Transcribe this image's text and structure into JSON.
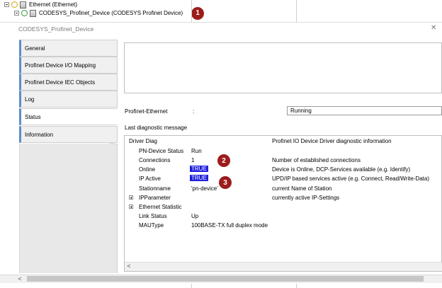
{
  "tree": {
    "ethernet_label": "Ethernet (Ethernet)",
    "device_label": "CODESYS_Profinet_Device (CODESYS Profinet Device)",
    "badge_1": "1"
  },
  "dialog": {
    "title": "CODESYS_Profinet_Device",
    "close_glyph": "✕"
  },
  "tabs": [
    {
      "label": "General"
    },
    {
      "label": "Profinet Device I/O Mapping"
    },
    {
      "label": "Profinet Device IEC Objects"
    },
    {
      "label": "Log"
    },
    {
      "label": "Status"
    },
    {
      "label": "Information"
    }
  ],
  "status": {
    "profinet_ethernet_label": "Profinet-Ethernet",
    "colon": ":",
    "state_value": "Running",
    "last_diag_label": "Last diagnostic message"
  },
  "diag": {
    "header_name": "Driver Diag",
    "header_desc": "Profinet IO Device Driver diagnostic information",
    "rows": [
      {
        "name": "PN-Device Status",
        "value": "Run",
        "desc": ""
      },
      {
        "name": "Connections",
        "value": "1",
        "desc": "Number of established connections"
      },
      {
        "name": "Online",
        "value": "TRUE",
        "desc": "Device is Online, DCP-Services available (e.g. Identify)"
      },
      {
        "name": "IP Active",
        "value": "TRUE",
        "desc": "UPD/IP based services active (e.g. Connect, Read/Write-Data)"
      },
      {
        "name": "Stationname",
        "value": "'pn-device'",
        "desc": "current Name of Station"
      },
      {
        "name": "IPParameter",
        "value": "",
        "desc": "currently active IP-Settings"
      },
      {
        "name": "Ethernet Statistic",
        "value": "",
        "desc": ""
      },
      {
        "name": "Link Status",
        "value": "Up",
        "desc": ""
      },
      {
        "name": "MAUType",
        "value": "100BASE-TX full duplex mode",
        "desc": ""
      }
    ],
    "badge_2": "2",
    "badge_3": "3"
  },
  "scroll": {
    "left_arrow": "<"
  },
  "colors": {
    "badge": "#9c1c1c",
    "true_highlight": "#1f1fe0",
    "tab_accent": "#5a8ec8"
  }
}
